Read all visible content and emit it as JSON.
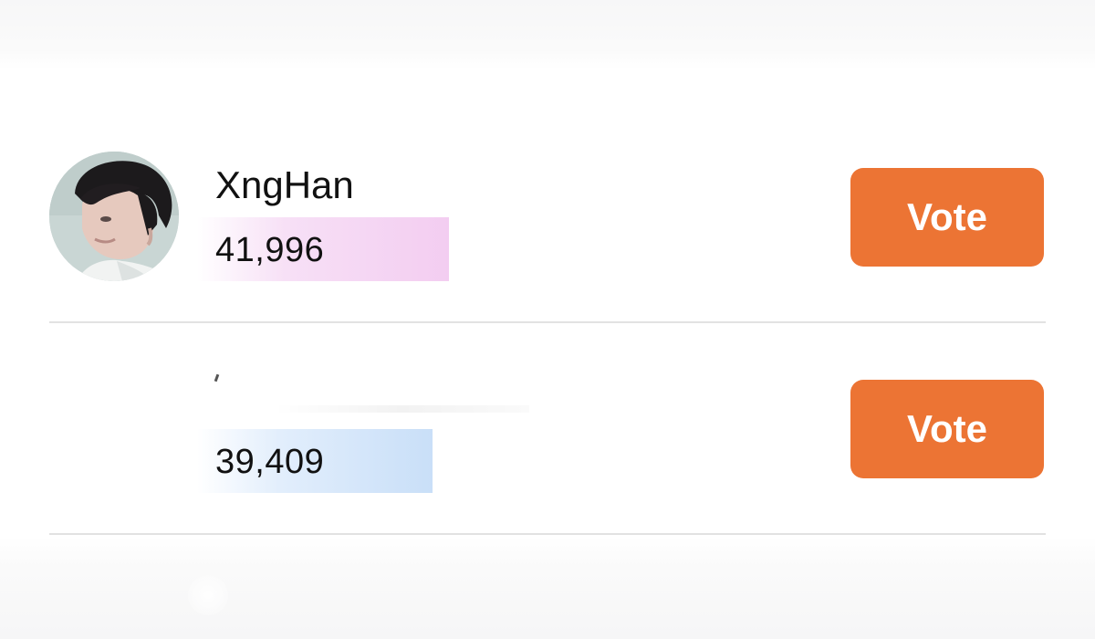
{
  "leaderboard": {
    "entries": [
      {
        "name": "XngHan",
        "votes": "41,996",
        "vote_label": "Vote",
        "bar_color": "#f3cdf1",
        "has_avatar": true
      },
      {
        "name": "",
        "votes": "39,409",
        "vote_label": "Vote",
        "bar_color": "#c9dff8",
        "has_avatar": false
      }
    ]
  },
  "colors": {
    "vote_button": "#ec7434",
    "divider": "#e2e2e2",
    "text": "#111111"
  }
}
